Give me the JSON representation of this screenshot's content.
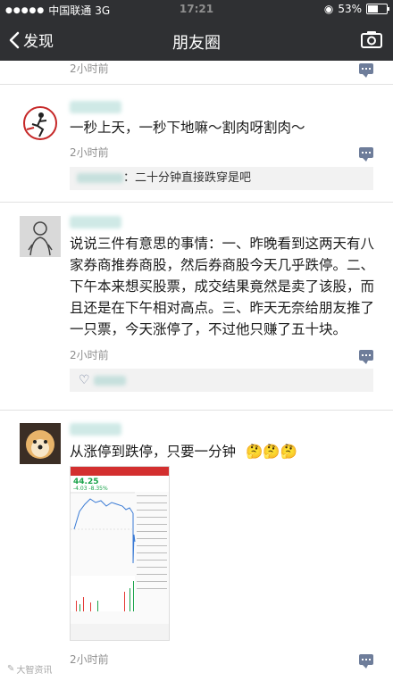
{
  "status_bar": {
    "carrier": "中国联通",
    "network": "3G",
    "time": "17:21",
    "battery": "53%",
    "battery_level": 0.53
  },
  "nav": {
    "back_label": "发现",
    "title": "朋友圈"
  },
  "posts": [
    {
      "time": "2小时前"
    },
    {
      "text": "一秒上天，一秒下地嘛～割肉呀割肉～",
      "time": "2小时前",
      "comment": "：二十分钟直接跌穿是吧"
    },
    {
      "text": "说说三件有意思的事情：一、昨晚看到这两天有八家券商推券商股，然后券商股今天几乎跌停。二、下午本来想买股票，成交结果竟然是卖了该股，而且还是在下午相对高点。三、昨天无奈给朋友推了一只票，今天涨停了，不过他只赚了五十块。",
      "time": "2小时前"
    },
    {
      "text": "从涨停到跌停，只要一分钟",
      "emoji": "🤔🤔🤔",
      "time": "2小时前",
      "thumb": {
        "price": "44.25",
        "change": "-4.03 -8.35%"
      }
    }
  ],
  "watermark": "大智资讯",
  "colors": {
    "bar_bg": "#2f3033",
    "link": "#6e7d9a",
    "price_green": "#1aa34a",
    "price_red": "#e53935"
  }
}
